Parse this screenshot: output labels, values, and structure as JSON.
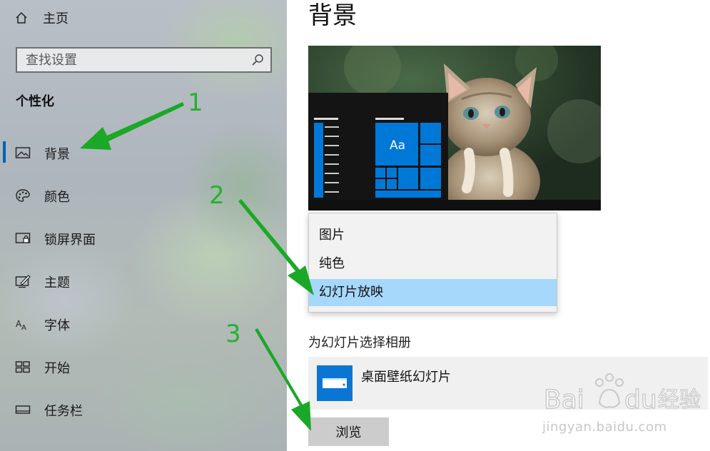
{
  "sidebar": {
    "home_label": "主页",
    "search_placeholder": "查找设置",
    "section_title": "个性化",
    "items": [
      {
        "label": "背景",
        "icon": "picture-icon",
        "active": true
      },
      {
        "label": "颜色",
        "icon": "palette-icon",
        "active": false
      },
      {
        "label": "锁屏界面",
        "icon": "lock-screen-icon",
        "active": false
      },
      {
        "label": "主题",
        "icon": "theme-icon",
        "active": false
      },
      {
        "label": "字体",
        "icon": "font-icon",
        "active": false
      },
      {
        "label": "开始",
        "icon": "start-icon",
        "active": false
      },
      {
        "label": "任务栏",
        "icon": "taskbar-icon",
        "active": false
      }
    ]
  },
  "main": {
    "title": "背景",
    "preview": {
      "tile_label": "Aa"
    },
    "dropdown": {
      "options": [
        "图片",
        "纯色",
        "幻灯片放映"
      ],
      "selected": "幻灯片放映"
    },
    "album_heading": "为幻灯片选择相册",
    "album_name": "桌面壁纸幻灯片",
    "browse_label": "浏览"
  },
  "annotations": {
    "numbers": [
      "1",
      "2",
      "3"
    ],
    "color": "#22b22e"
  },
  "watermark": {
    "logo_text": "Bai du 经验",
    "url": "jingyan.baidu.com"
  },
  "colors": {
    "accent": "#0078d7",
    "selected_option": "#a6d8fb",
    "active_indicator": "#0063b1"
  }
}
